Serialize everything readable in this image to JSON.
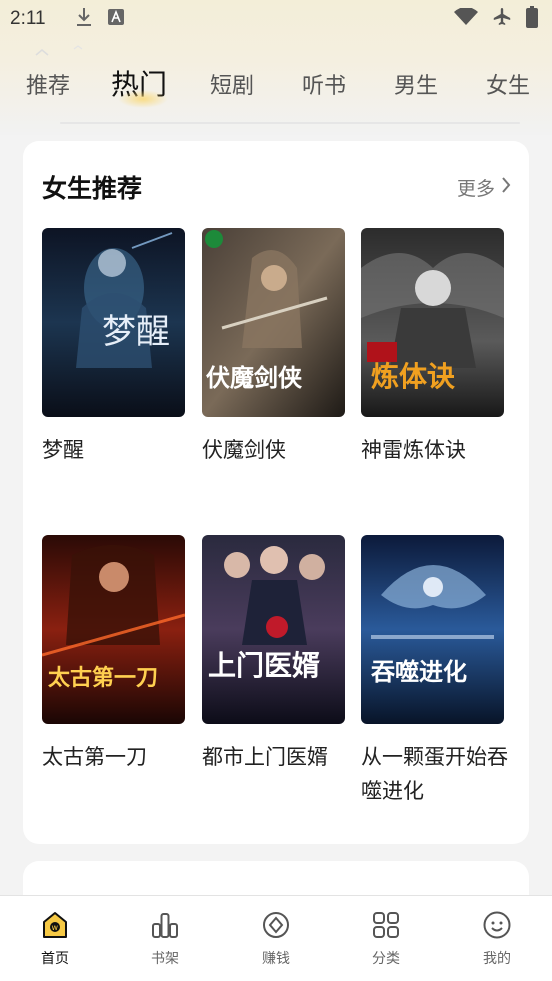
{
  "status_bar": {
    "time": "2:11"
  },
  "tabs": [
    {
      "label": "推荐"
    },
    {
      "label": "热门"
    },
    {
      "label": "短剧"
    },
    {
      "label": "听书"
    },
    {
      "label": "男生"
    },
    {
      "label": "女生"
    }
  ],
  "active_tab": "热门",
  "section": {
    "title": "女生推荐",
    "more_label": "更多"
  },
  "books": [
    {
      "title": "梦醒",
      "cover_text": "梦醒"
    },
    {
      "title": "伏魔剑侠",
      "cover_text": "伏魔剑侠"
    },
    {
      "title": "神雷炼体诀",
      "cover_text": "炼体诀"
    },
    {
      "title": "太古第一刀",
      "cover_text": "太古第一刀"
    },
    {
      "title": "都市上门医婿",
      "cover_text": "上门医婿"
    },
    {
      "title": "从一颗蛋开始吞噬进化",
      "cover_text": "吞噬进化"
    }
  ],
  "bottom_nav": [
    {
      "label": "首页",
      "icon": "home-icon"
    },
    {
      "label": "书架",
      "icon": "bookshelf-icon"
    },
    {
      "label": "赚钱",
      "icon": "earn-icon"
    },
    {
      "label": "分类",
      "icon": "category-icon"
    },
    {
      "label": "我的",
      "icon": "profile-icon"
    }
  ],
  "colors": {
    "accent": "#f6c945",
    "background": "#f3f3f3",
    "card": "#ffffff"
  }
}
